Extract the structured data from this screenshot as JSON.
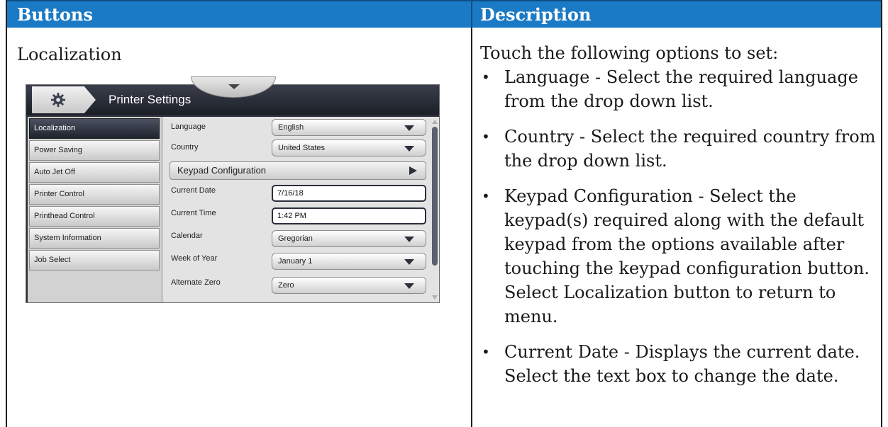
{
  "table": {
    "headers": [
      "Buttons",
      "Description"
    ],
    "row_title": "Localization"
  },
  "description": {
    "intro": "Touch the following options to set:",
    "items": [
      "Language - Select the required language from the drop down list.",
      "Country - Select the required country from the drop down list.",
      "Keypad Configuration - Select the keypad(s) required along with the default keypad from the options available after touching the keypad configuration button.",
      "Current Date - Displays the current date. Select the text box to change the date."
    ],
    "item3_note": "Select Localization button to return to menu."
  },
  "screenshot": {
    "title": "Printer Settings",
    "header_icon": "gear-icon",
    "sidebar": [
      "Localization",
      "Power Saving",
      "Auto Jet Off",
      "Printer Control",
      "Printhead Control",
      "System Information",
      "Job Select"
    ],
    "active_sidebar_item": "Localization",
    "settings": {
      "language": {
        "label": "Language",
        "value": "English"
      },
      "country": {
        "label": "Country",
        "value": "United States"
      },
      "keypad": {
        "label": "Keypad Configuration"
      },
      "current_date": {
        "label": "Current Date",
        "value": "7/16/18"
      },
      "current_time": {
        "label": "Current Time",
        "value": "1:42 PM"
      },
      "calendar": {
        "label": "Calendar",
        "value": "Gregorian"
      },
      "week_of_year": {
        "label": "Week of Year",
        "value": "January 1"
      },
      "alternate_zero": {
        "label": "Alternate Zero",
        "value": "Zero"
      }
    },
    "colors": {
      "header_dark": "#1c1f27",
      "active_item": "#2a2f3a",
      "table_header": "#1b7ac5"
    }
  }
}
